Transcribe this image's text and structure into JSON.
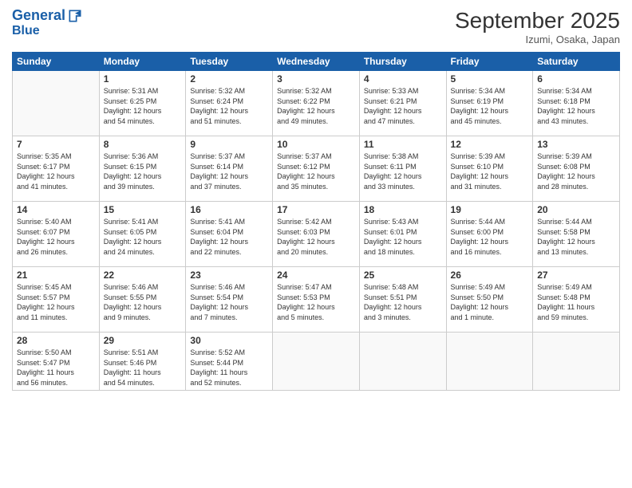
{
  "header": {
    "logo_line1": "General",
    "logo_line2": "Blue",
    "month": "September 2025",
    "location": "Izumi, Osaka, Japan"
  },
  "weekdays": [
    "Sunday",
    "Monday",
    "Tuesday",
    "Wednesday",
    "Thursday",
    "Friday",
    "Saturday"
  ],
  "weeks": [
    [
      {
        "day": "",
        "text": ""
      },
      {
        "day": "1",
        "text": "Sunrise: 5:31 AM\nSunset: 6:25 PM\nDaylight: 12 hours\nand 54 minutes."
      },
      {
        "day": "2",
        "text": "Sunrise: 5:32 AM\nSunset: 6:24 PM\nDaylight: 12 hours\nand 51 minutes."
      },
      {
        "day": "3",
        "text": "Sunrise: 5:32 AM\nSunset: 6:22 PM\nDaylight: 12 hours\nand 49 minutes."
      },
      {
        "day": "4",
        "text": "Sunrise: 5:33 AM\nSunset: 6:21 PM\nDaylight: 12 hours\nand 47 minutes."
      },
      {
        "day": "5",
        "text": "Sunrise: 5:34 AM\nSunset: 6:19 PM\nDaylight: 12 hours\nand 45 minutes."
      },
      {
        "day": "6",
        "text": "Sunrise: 5:34 AM\nSunset: 6:18 PM\nDaylight: 12 hours\nand 43 minutes."
      }
    ],
    [
      {
        "day": "7",
        "text": "Sunrise: 5:35 AM\nSunset: 6:17 PM\nDaylight: 12 hours\nand 41 minutes."
      },
      {
        "day": "8",
        "text": "Sunrise: 5:36 AM\nSunset: 6:15 PM\nDaylight: 12 hours\nand 39 minutes."
      },
      {
        "day": "9",
        "text": "Sunrise: 5:37 AM\nSunset: 6:14 PM\nDaylight: 12 hours\nand 37 minutes."
      },
      {
        "day": "10",
        "text": "Sunrise: 5:37 AM\nSunset: 6:12 PM\nDaylight: 12 hours\nand 35 minutes."
      },
      {
        "day": "11",
        "text": "Sunrise: 5:38 AM\nSunset: 6:11 PM\nDaylight: 12 hours\nand 33 minutes."
      },
      {
        "day": "12",
        "text": "Sunrise: 5:39 AM\nSunset: 6:10 PM\nDaylight: 12 hours\nand 31 minutes."
      },
      {
        "day": "13",
        "text": "Sunrise: 5:39 AM\nSunset: 6:08 PM\nDaylight: 12 hours\nand 28 minutes."
      }
    ],
    [
      {
        "day": "14",
        "text": "Sunrise: 5:40 AM\nSunset: 6:07 PM\nDaylight: 12 hours\nand 26 minutes."
      },
      {
        "day": "15",
        "text": "Sunrise: 5:41 AM\nSunset: 6:05 PM\nDaylight: 12 hours\nand 24 minutes."
      },
      {
        "day": "16",
        "text": "Sunrise: 5:41 AM\nSunset: 6:04 PM\nDaylight: 12 hours\nand 22 minutes."
      },
      {
        "day": "17",
        "text": "Sunrise: 5:42 AM\nSunset: 6:03 PM\nDaylight: 12 hours\nand 20 minutes."
      },
      {
        "day": "18",
        "text": "Sunrise: 5:43 AM\nSunset: 6:01 PM\nDaylight: 12 hours\nand 18 minutes."
      },
      {
        "day": "19",
        "text": "Sunrise: 5:44 AM\nSunset: 6:00 PM\nDaylight: 12 hours\nand 16 minutes."
      },
      {
        "day": "20",
        "text": "Sunrise: 5:44 AM\nSunset: 5:58 PM\nDaylight: 12 hours\nand 13 minutes."
      }
    ],
    [
      {
        "day": "21",
        "text": "Sunrise: 5:45 AM\nSunset: 5:57 PM\nDaylight: 12 hours\nand 11 minutes."
      },
      {
        "day": "22",
        "text": "Sunrise: 5:46 AM\nSunset: 5:55 PM\nDaylight: 12 hours\nand 9 minutes."
      },
      {
        "day": "23",
        "text": "Sunrise: 5:46 AM\nSunset: 5:54 PM\nDaylight: 12 hours\nand 7 minutes."
      },
      {
        "day": "24",
        "text": "Sunrise: 5:47 AM\nSunset: 5:53 PM\nDaylight: 12 hours\nand 5 minutes."
      },
      {
        "day": "25",
        "text": "Sunrise: 5:48 AM\nSunset: 5:51 PM\nDaylight: 12 hours\nand 3 minutes."
      },
      {
        "day": "26",
        "text": "Sunrise: 5:49 AM\nSunset: 5:50 PM\nDaylight: 12 hours\nand 1 minute."
      },
      {
        "day": "27",
        "text": "Sunrise: 5:49 AM\nSunset: 5:48 PM\nDaylight: 11 hours\nand 59 minutes."
      }
    ],
    [
      {
        "day": "28",
        "text": "Sunrise: 5:50 AM\nSunset: 5:47 PM\nDaylight: 11 hours\nand 56 minutes."
      },
      {
        "day": "29",
        "text": "Sunrise: 5:51 AM\nSunset: 5:46 PM\nDaylight: 11 hours\nand 54 minutes."
      },
      {
        "day": "30",
        "text": "Sunrise: 5:52 AM\nSunset: 5:44 PM\nDaylight: 11 hours\nand 52 minutes."
      },
      {
        "day": "",
        "text": ""
      },
      {
        "day": "",
        "text": ""
      },
      {
        "day": "",
        "text": ""
      },
      {
        "day": "",
        "text": ""
      }
    ]
  ]
}
